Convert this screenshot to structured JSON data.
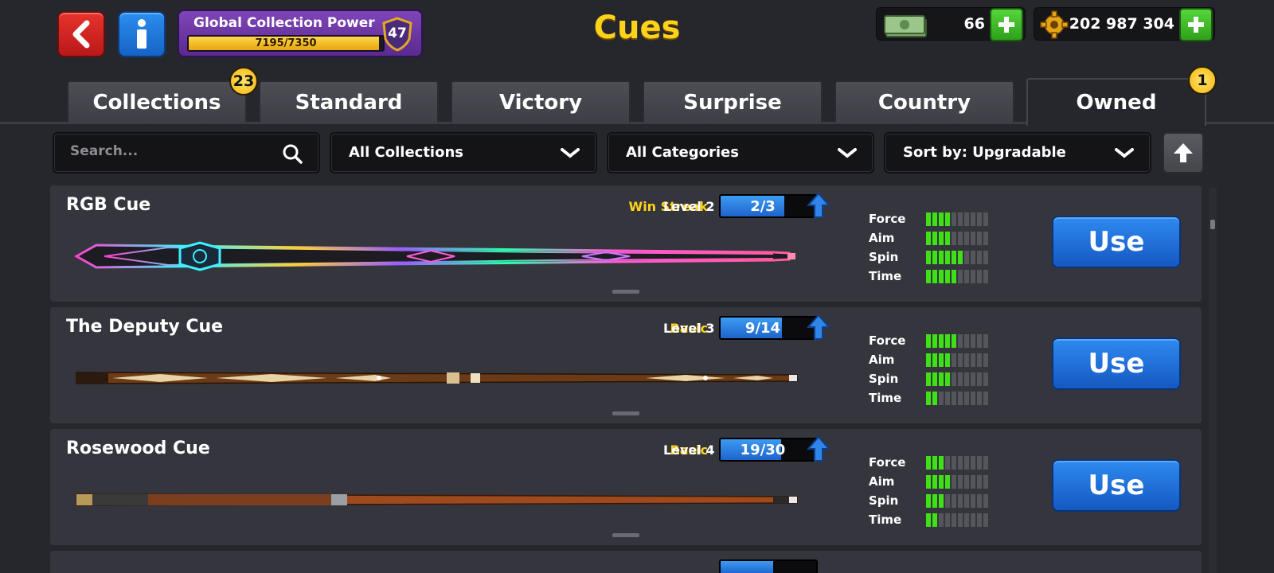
{
  "header": {
    "title": "Cues",
    "gcp_title": "Global Collection Power",
    "gcp_progress": "7195/7350",
    "gcp_fraction": 0.979,
    "gcp_level": "47",
    "cash": "66",
    "coins": "202 987 304"
  },
  "tabs": [
    {
      "label": "Collections",
      "badge": "23"
    },
    {
      "label": "Standard"
    },
    {
      "label": "Victory"
    },
    {
      "label": "Surprise"
    },
    {
      "label": "Country"
    },
    {
      "label": "Owned",
      "badge": "1",
      "active": true
    }
  ],
  "filters": {
    "search_placeholder": "Search...",
    "collection": "All Collections",
    "category": "All Categories",
    "sort": "Sort by: Upgradable"
  },
  "stat_labels": [
    "Force",
    "Aim",
    "Spin",
    "Time"
  ],
  "use_label": "Use",
  "cues": [
    {
      "name": "RGB Cue",
      "category": "Win Streak",
      "level": "Level 2",
      "progress": "2/3",
      "fraction": 0.667,
      "stats": [
        4,
        4,
        6,
        5
      ]
    },
    {
      "name": "The Deputy Cue",
      "category": "Basic",
      "level": "Level 3",
      "progress": "9/14",
      "fraction": 0.643,
      "stats": [
        5,
        4,
        4,
        2
      ]
    },
    {
      "name": "Rosewood Cue",
      "category": "Basic",
      "level": "Level 4",
      "progress": "19/30",
      "fraction": 0.633,
      "stats": [
        3,
        4,
        3,
        2
      ]
    }
  ],
  "colors": {
    "accent_yellow": "#ffd21a",
    "stat_green": "#3fe016",
    "button_blue": "#1e6fe0"
  }
}
